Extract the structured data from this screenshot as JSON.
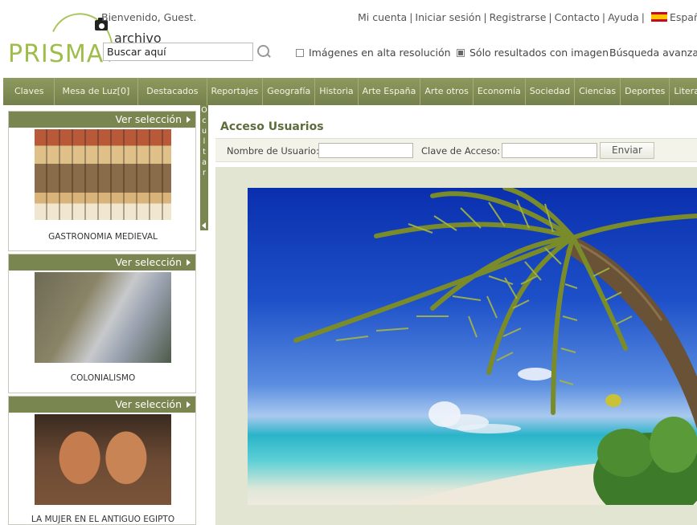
{
  "header": {
    "welcome": "Bienvenido, Guest.",
    "logo_text": "PRISMA",
    "logo_sub": "archivo",
    "toplinks": [
      "Mi cuenta",
      "Iniciar sesión",
      "Registrarse",
      "Contacto",
      "Ayuda"
    ],
    "language": "Español"
  },
  "search": {
    "value": "Buscar aquí",
    "opt_highres": "Imágenes en alta resolución",
    "opt_highres_checked": false,
    "opt_withimage": "Sólo resultados con imagen",
    "opt_withimage_checked": true,
    "advanced": "Búsqueda avanzada"
  },
  "nav": [
    "Claves",
    "Mesa de Luz[0]",
    "Destacados",
    "Reportajes",
    "Geografía",
    "Historia",
    "Arte España",
    "Arte otros",
    "Economía",
    "Sociedad",
    "Ciencias",
    "Deportes",
    "Literatura"
  ],
  "sidebar": {
    "ver_label": "Ver selección",
    "cards": [
      {
        "caption": "GASTRONOMIA MEDIEVAL"
      },
      {
        "caption": "COLONIALISMO"
      },
      {
        "caption": "LA MUJER EN EL ANTIGUO EGIPTO"
      }
    ],
    "ocultar": [
      "O",
      "c",
      "u",
      "l",
      "t",
      "a",
      "r"
    ]
  },
  "main": {
    "title": "Acceso Usuarios",
    "username_label": "Nombre de Usuario:",
    "password_label": "Clave de Acceso:",
    "send_label": "Enviar"
  },
  "colors": {
    "nav_bg": "#7e8a54",
    "accent_green": "#7a8650",
    "title_green": "#5e6b3a",
    "logo_green": "#9fbd4a"
  }
}
